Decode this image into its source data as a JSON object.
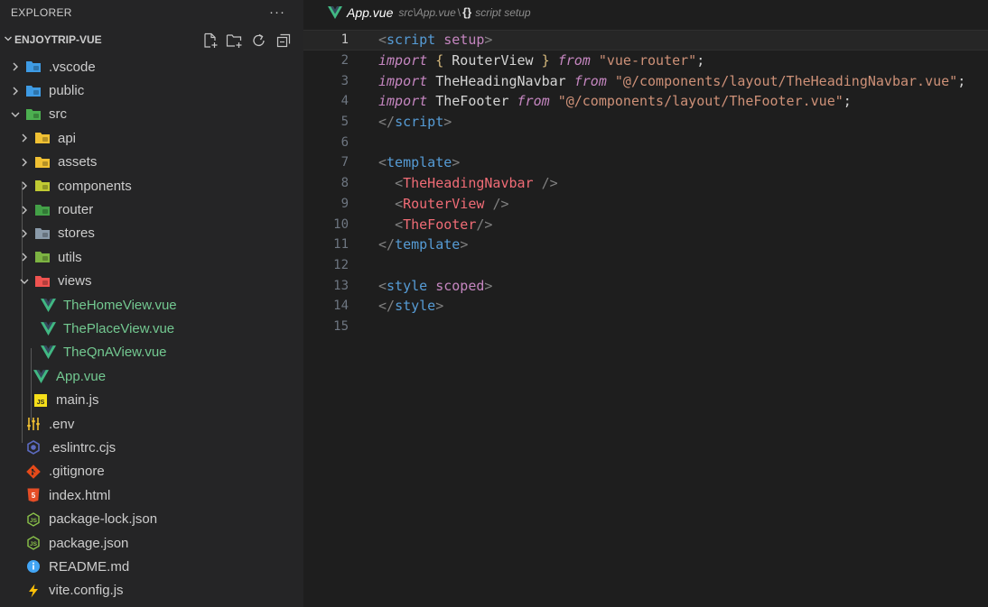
{
  "sidebar": {
    "header_title": "EXPLORER",
    "more_label": "···",
    "root_label": "ENJOYTRIP-VUE",
    "root_actions": [
      "new-file-icon",
      "new-folder-icon",
      "refresh-icon",
      "collapse-all-icon"
    ],
    "items": [
      {
        "label": ".vscode",
        "type": "folder",
        "icon": "vscode-folder-icon",
        "color": "#3e9be4"
      },
      {
        "label": "public",
        "type": "folder",
        "icon": "public-folder-icon",
        "color": "#3e9be4"
      },
      {
        "label": "src",
        "type": "folder-open",
        "icon": "src-folder-icon",
        "color": "#4caf50"
      },
      {
        "label": "api",
        "type": "folder",
        "icon": "api-folder-icon",
        "color": "#f0c033"
      },
      {
        "label": "assets",
        "type": "folder",
        "icon": "assets-folder-icon",
        "color": "#f0c033"
      },
      {
        "label": "components",
        "type": "folder",
        "icon": "components-folder-icon",
        "color": "#c0ca33"
      },
      {
        "label": "router",
        "type": "folder",
        "icon": "router-folder-icon",
        "color": "#43a047"
      },
      {
        "label": "stores",
        "type": "folder",
        "icon": "stores-folder-icon",
        "color": "#8a9aa9"
      },
      {
        "label": "utils",
        "type": "folder",
        "icon": "utils-folder-icon",
        "color": "#7cb342"
      },
      {
        "label": "views",
        "type": "folder-open",
        "icon": "views-folder-icon",
        "color": "#ef5350"
      },
      {
        "label": "TheHomeView.vue",
        "type": "vue",
        "icon": "vue-icon",
        "color": "#41b883"
      },
      {
        "label": "ThePlaceView.vue",
        "type": "vue",
        "icon": "vue-icon",
        "color": "#41b883"
      },
      {
        "label": "TheQnAView.vue",
        "type": "vue",
        "icon": "vue-icon",
        "color": "#41b883"
      },
      {
        "label": "App.vue",
        "type": "vue",
        "icon": "vue-icon",
        "color": "#41b883"
      },
      {
        "label": "main.js",
        "type": "js",
        "icon": "js-icon",
        "color": "#f5de19"
      },
      {
        "label": ".env",
        "type": "env",
        "icon": "env-icon",
        "color": "#f0c033"
      },
      {
        "label": ".eslintrc.cjs",
        "type": "eslint",
        "icon": "eslint-icon",
        "color": "#5c6bc0"
      },
      {
        "label": ".gitignore",
        "type": "git",
        "icon": "git-icon",
        "color": "#e64a19"
      },
      {
        "label": "index.html",
        "type": "html",
        "icon": "html-icon",
        "color": "#e44d26"
      },
      {
        "label": "package-lock.json",
        "type": "node",
        "icon": "nodejs-icon",
        "color": "#8bc34a"
      },
      {
        "label": "package.json",
        "type": "node",
        "icon": "nodejs-icon",
        "color": "#8bc34a"
      },
      {
        "label": "README.md",
        "type": "info",
        "icon": "info-icon",
        "color": "#42a5f5"
      },
      {
        "label": "vite.config.js",
        "type": "vite",
        "icon": "vite-icon",
        "color": "#ffc107"
      }
    ]
  },
  "breadcrumb": {
    "file": "App.vue",
    "path": "src\\App.vue",
    "separator": "\\",
    "scope_icon": "{}",
    "scope": "script setup"
  },
  "editor": {
    "current_line": 1,
    "lines": [
      [
        [
          "tk-bracket",
          "<"
        ],
        [
          "tk-tag",
          "script"
        ],
        [
          "tk-punc",
          " "
        ],
        [
          "tk-attr",
          "setup"
        ],
        [
          "tk-bracket",
          ">"
        ]
      ],
      [
        [
          "tk-kw",
          "import"
        ],
        [
          "tk-punc",
          " "
        ],
        [
          "tk-brace",
          "{"
        ],
        [
          "tk-id",
          " RouterView "
        ],
        [
          "tk-brace",
          "}"
        ],
        [
          "tk-punc",
          " "
        ],
        [
          "tk-kw",
          "from"
        ],
        [
          "tk-punc",
          " "
        ],
        [
          "tk-str",
          "\"vue-router\""
        ],
        [
          "tk-punc",
          ";"
        ]
      ],
      [
        [
          "tk-kw",
          "import"
        ],
        [
          "tk-id",
          " TheHeadingNavbar "
        ],
        [
          "tk-kw",
          "from"
        ],
        [
          "tk-punc",
          " "
        ],
        [
          "tk-str",
          "\"@/components/layout/TheHeadingNavbar.vue\""
        ],
        [
          "tk-punc",
          ";"
        ]
      ],
      [
        [
          "tk-kw",
          "import"
        ],
        [
          "tk-id",
          " TheFooter "
        ],
        [
          "tk-kw",
          "from"
        ],
        [
          "tk-punc",
          " "
        ],
        [
          "tk-str",
          "\"@/components/layout/TheFooter.vue\""
        ],
        [
          "tk-punc",
          ";"
        ]
      ],
      [
        [
          "tk-bracket",
          "</"
        ],
        [
          "tk-tag",
          "script"
        ],
        [
          "tk-bracket",
          ">"
        ]
      ],
      [],
      [
        [
          "tk-bracket",
          "<"
        ],
        [
          "tk-tag",
          "template"
        ],
        [
          "tk-bracket",
          ">"
        ]
      ],
      [
        [
          "tk-punc",
          "  "
        ],
        [
          "tk-bracket",
          "<"
        ],
        [
          "tk-comp",
          "TheHeadingNavbar"
        ],
        [
          "tk-punc",
          " "
        ],
        [
          "tk-bracket",
          "/>"
        ]
      ],
      [
        [
          "tk-punc",
          "  "
        ],
        [
          "tk-bracket",
          "<"
        ],
        [
          "tk-comp",
          "RouterView"
        ],
        [
          "tk-punc",
          " "
        ],
        [
          "tk-bracket",
          "/>"
        ]
      ],
      [
        [
          "tk-punc",
          "  "
        ],
        [
          "tk-bracket",
          "<"
        ],
        [
          "tk-comp",
          "TheFooter"
        ],
        [
          "tk-bracket",
          "/>"
        ]
      ],
      [
        [
          "tk-bracket",
          "</"
        ],
        [
          "tk-tag",
          "template"
        ],
        [
          "tk-bracket",
          ">"
        ]
      ],
      [],
      [
        [
          "tk-bracket",
          "<"
        ],
        [
          "tk-tag",
          "style"
        ],
        [
          "tk-punc",
          " "
        ],
        [
          "tk-attr",
          "scoped"
        ],
        [
          "tk-bracket",
          ">"
        ]
      ],
      [
        [
          "tk-bracket",
          "</"
        ],
        [
          "tk-tag",
          "style"
        ],
        [
          "tk-bracket",
          ">"
        ]
      ],
      []
    ]
  }
}
